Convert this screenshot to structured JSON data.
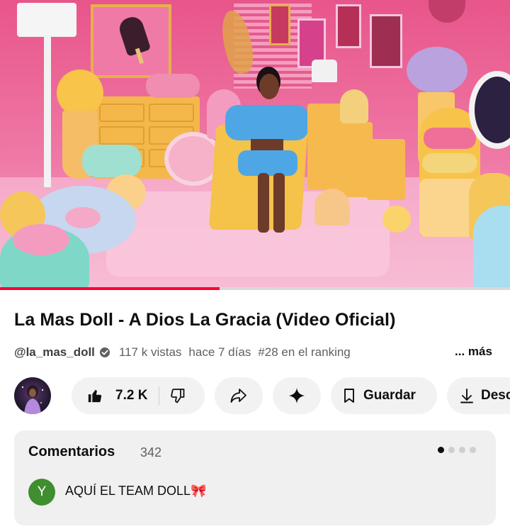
{
  "video": {
    "progress_percent": 43
  },
  "info": {
    "title": "La Mas Doll - A Dios La Gracia (Video Oficial)",
    "channel_handle": "@la_mas_doll",
    "views": "117 k vistas",
    "uploaded": "hace 7 días",
    "ranking": "#28 en el ranking",
    "more_label": "... más"
  },
  "actions": {
    "like_count": "7.2 K",
    "save_label": "Guardar",
    "download_label": "Desc"
  },
  "comments": {
    "heading": "Comentarios",
    "count": "342",
    "carousel_active_index": 1,
    "carousel_total": 4,
    "top_comment": {
      "avatar_letter": "Y",
      "avatar_color": "#3f8e2f",
      "text": "AQUÍ EL TEAM DOLL🎀"
    }
  },
  "colors": {
    "progress": "#ff0033",
    "pill_background": "#f2f2f2",
    "comments_background": "#f0f0f0"
  },
  "icons": [
    "verified-icon",
    "thumbs-up-icon",
    "thumbs-down-icon",
    "share-icon",
    "sparkle-icon",
    "bookmark-icon",
    "download-icon"
  ]
}
